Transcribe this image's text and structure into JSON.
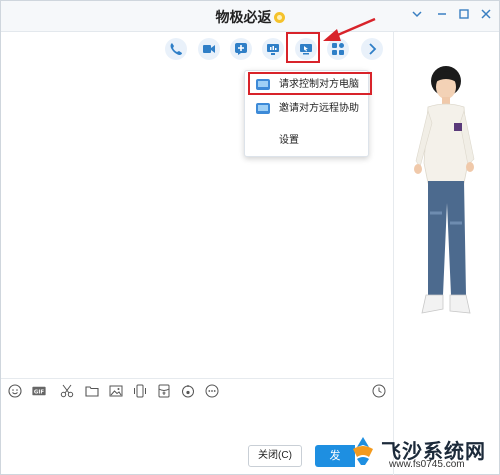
{
  "window": {
    "title": "物极必返"
  },
  "toolbar": {
    "buttons": [
      "phone-icon",
      "video-icon",
      "add-icon",
      "share-screen-icon",
      "remote-desktop-icon",
      "apps-icon",
      "chevron-right-icon"
    ]
  },
  "menu": {
    "items": [
      {
        "label": "请求控制对方电脑",
        "icon": "remote-control-icon"
      },
      {
        "label": "邀请对方远程协助",
        "icon": "remote-assist-icon"
      },
      {
        "label": "设置"
      }
    ]
  },
  "input_tools": [
    "emoji-icon",
    "gif-icon",
    "scissors-icon",
    "folder-icon",
    "image-icon",
    "shake-icon",
    "red-packet-icon",
    "music-icon",
    "more-icon",
    "history-icon"
  ],
  "buttons": {
    "close": "关闭(C)",
    "send": "发"
  },
  "watermark": {
    "text": "飞沙系统网",
    "url": "www.fs0745.com"
  },
  "colors": {
    "accent": "#1e8fe1",
    "highlight": "#d8232a"
  }
}
